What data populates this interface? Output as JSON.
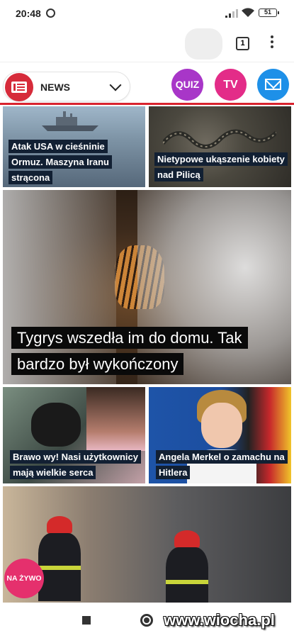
{
  "status_bar": {
    "time": "20:48",
    "battery": "51"
  },
  "browser": {
    "tab_count": "1"
  },
  "header": {
    "section_label": "NEWS",
    "quiz_label": "QUIZ",
    "tv_label": "TV",
    "accent_color": "#d9232e"
  },
  "articles": [
    {
      "title": "Atak USA w cieśninie Ormuz. Maszyna Iranu strącona"
    },
    {
      "title": "Nietypowe ukąszenie kobiety nad Pilicą"
    },
    {
      "title": "Tygrys wszedła im do domu. Tak bardzo był wykończony"
    },
    {
      "title": "Brawo wy! Nasi użytkownicy mają wielkie serca"
    },
    {
      "title": "Angela Merkel o zamachu na Hitlera"
    }
  ],
  "live_badge": "NA ŻYWO",
  "watermark": "www.wiocha.pl",
  "icons": [
    "alarm-icon",
    "signal-icon",
    "wifi-icon",
    "battery-icon",
    "menu-dots-icon",
    "chevron-down-icon",
    "mail-icon",
    "nav-square-icon",
    "nav-circle-icon"
  ]
}
